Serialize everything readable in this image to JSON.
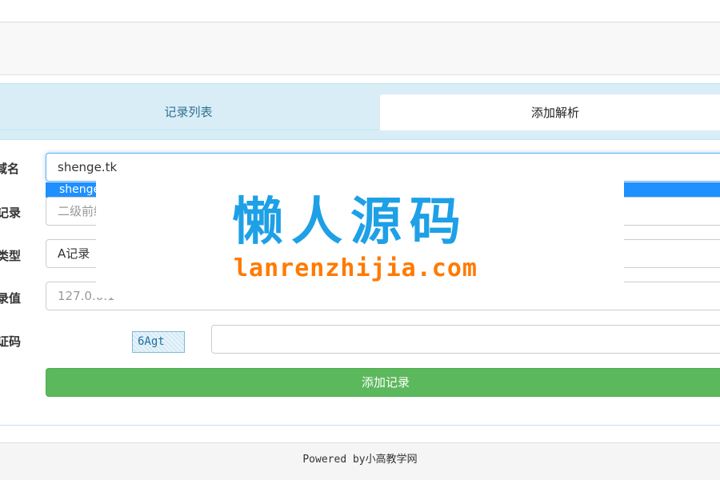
{
  "tabs": {
    "list_label": "记录列表",
    "add_label": "添加解析"
  },
  "form": {
    "domain": {
      "label": "域名",
      "value": "shenge.tk"
    },
    "suggestion": "shenge",
    "record": {
      "label": "记录",
      "placeholder": "二级前缀"
    },
    "type": {
      "label": "类型",
      "value": "A记录"
    },
    "record_value": {
      "label": "录值",
      "placeholder": "127.0.0.1"
    },
    "captcha": {
      "label": "证码",
      "code": "6Agt",
      "value": ""
    },
    "submit_label": "添加记录"
  },
  "watermark": {
    "title": "懒人源码",
    "url": "lanrenzhijia.com"
  },
  "footer": {
    "text": "Powered by小高教学网"
  },
  "colors": {
    "tab_bar": "#d9edf7",
    "active_tab": "#ffffff",
    "submit": "#5cb85c",
    "suggestion_highlight": "#1e90ff",
    "watermark_title": "#1ea0e6",
    "watermark_url": "#ff7a00"
  }
}
